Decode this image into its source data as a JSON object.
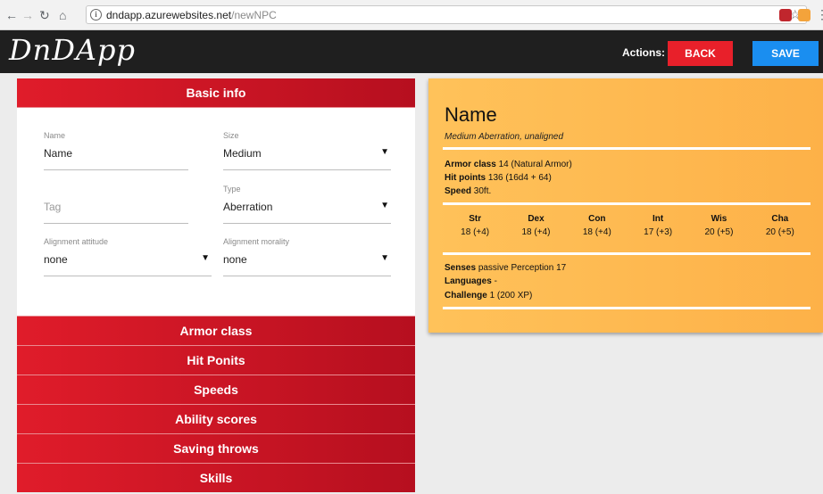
{
  "browser": {
    "url_host": "dndapp.azurewebsites.net",
    "url_path": "/newNPC"
  },
  "header": {
    "logo": "DnDApp",
    "actions_label": "Actions:",
    "back_label": "BACK",
    "save_label": "SAVE",
    "back_color": "#e8202a",
    "save_color": "#1a8ef0"
  },
  "basic_info": {
    "title": "Basic info",
    "name": {
      "label": "Name",
      "value": "Name"
    },
    "size": {
      "label": "Size",
      "value": "Medium"
    },
    "tag": {
      "placeholder": "Tag"
    },
    "type": {
      "label": "Type",
      "value": "Aberration"
    },
    "alignment_attitude": {
      "label": "Alignment attitude",
      "value": "none"
    },
    "alignment_morality": {
      "label": "Alignment morality",
      "value": "none"
    }
  },
  "sections": [
    {
      "label": "Armor class"
    },
    {
      "label": "Hit Ponits"
    },
    {
      "label": "Speeds"
    },
    {
      "label": "Ability scores"
    },
    {
      "label": "Saving throws"
    },
    {
      "label": "Skills"
    }
  ],
  "card": {
    "name": "Name",
    "subtitle": "Medium Aberration, unaligned",
    "armor_class_label": "Armor class",
    "armor_class_value": "14 (Natural Armor)",
    "hit_points_label": "Hit points",
    "hit_points_value": "136 (16d4 + 64)",
    "speed_label": "Speed",
    "speed_value": "30ft.",
    "abilities": [
      {
        "name": "Str",
        "value": "18 (+4)"
      },
      {
        "name": "Dex",
        "value": "18 (+4)"
      },
      {
        "name": "Con",
        "value": "18 (+4)"
      },
      {
        "name": "Int",
        "value": "17 (+3)"
      },
      {
        "name": "Wis",
        "value": "20 (+5)"
      },
      {
        "name": "Cha",
        "value": "20 (+5)"
      }
    ],
    "senses_label": "Senses",
    "senses_value": "passive Perception 17",
    "languages_label": "Languages",
    "languages_value": "-",
    "challenge_label": "Challenge",
    "challenge_value": "1 (200 XP)"
  }
}
